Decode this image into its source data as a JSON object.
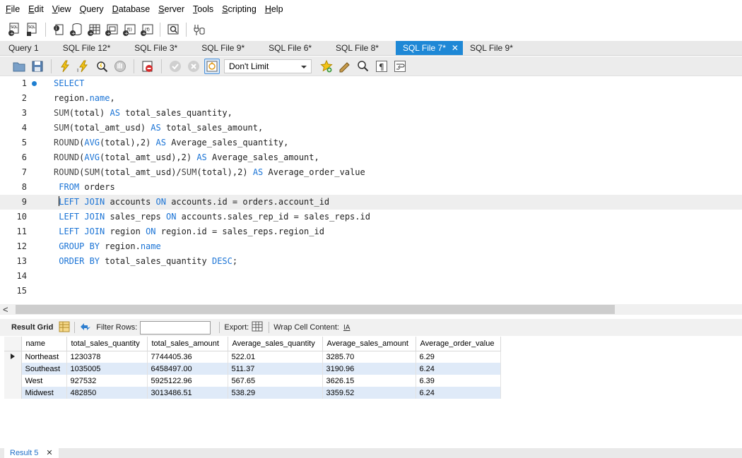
{
  "menu": [
    {
      "label": "File",
      "ul": "F",
      "rest": "ile"
    },
    {
      "label": "Edit",
      "ul": "E",
      "rest": "dit"
    },
    {
      "label": "View",
      "ul": "V",
      "rest": "iew"
    },
    {
      "label": "Query",
      "ul": "Q",
      "rest": "uery"
    },
    {
      "label": "Database",
      "ul": "D",
      "rest": "atabase"
    },
    {
      "label": "Server",
      "ul": "S",
      "rest": "erver"
    },
    {
      "label": "Tools",
      "ul": "T",
      "rest": "ools"
    },
    {
      "label": "Scripting",
      "ul": "S",
      "rest": "cripting"
    },
    {
      "label": "Help",
      "ul": "H",
      "rest": "elp"
    }
  ],
  "tabs": [
    {
      "label": "Query 1",
      "active": false
    },
    {
      "label": "SQL File 12*",
      "active": false
    },
    {
      "label": "SQL File 3*",
      "active": false
    },
    {
      "label": "SQL File 9*",
      "active": false
    },
    {
      "label": "SQL File 6*",
      "active": false
    },
    {
      "label": "SQL File 8*",
      "active": false
    },
    {
      "label": "SQL File 7*",
      "active": true
    },
    {
      "label": "SQL File 9*",
      "active": false
    }
  ],
  "editor_toolbar": {
    "limit_value": "Don't Limit"
  },
  "editor": {
    "current_line": 9,
    "lines": [
      {
        "n": "1",
        "tokens": [
          [
            "kw",
            "SELECT"
          ]
        ]
      },
      {
        "n": "2",
        "tokens": [
          [
            "t",
            "region."
          ],
          [
            "kw",
            "name"
          ],
          [
            "t",
            ","
          ]
        ]
      },
      {
        "n": "3",
        "tokens": [
          [
            "fn",
            "SUM"
          ],
          [
            "t",
            "(total) "
          ],
          [
            "kw",
            "AS"
          ],
          [
            "t",
            " total_sales_quantity,"
          ]
        ]
      },
      {
        "n": "4",
        "tokens": [
          [
            "fn",
            "SUM"
          ],
          [
            "t",
            "(total_amt_usd) "
          ],
          [
            "kw",
            "AS"
          ],
          [
            "t",
            " total_sales_amount,"
          ]
        ]
      },
      {
        "n": "5",
        "tokens": [
          [
            "fn",
            "ROUND"
          ],
          [
            "t",
            "("
          ],
          [
            "kw",
            "AVG"
          ],
          [
            "t",
            "(total),2) "
          ],
          [
            "kw",
            "AS"
          ],
          [
            "t",
            " Average_sales_quantity,"
          ]
        ]
      },
      {
        "n": "6",
        "tokens": [
          [
            "fn",
            "ROUND"
          ],
          [
            "t",
            "("
          ],
          [
            "kw",
            "AVG"
          ],
          [
            "t",
            "(total_amt_usd),2) "
          ],
          [
            "kw",
            "AS"
          ],
          [
            "t",
            " Average_sales_amount,"
          ]
        ]
      },
      {
        "n": "7",
        "tokens": [
          [
            "fn",
            "ROUND"
          ],
          [
            "t",
            "("
          ],
          [
            "fn",
            "SUM"
          ],
          [
            "t",
            "(total_amt_usd)/"
          ],
          [
            "fn",
            "SUM"
          ],
          [
            "t",
            "(total),2) "
          ],
          [
            "kw",
            "AS"
          ],
          [
            "t",
            " Average_order_value"
          ]
        ]
      },
      {
        "n": "8",
        "tokens": [
          [
            "t",
            " "
          ],
          [
            "kw",
            "FROM"
          ],
          [
            "t",
            " orders"
          ]
        ]
      },
      {
        "n": "9",
        "tokens": [
          [
            "t",
            " "
          ],
          [
            "kw",
            "LEFT JOIN"
          ],
          [
            "t",
            " accounts "
          ],
          [
            "kw",
            "ON"
          ],
          [
            "t",
            " accounts.id = orders.account_id"
          ]
        ]
      },
      {
        "n": "10",
        "tokens": [
          [
            "t",
            " "
          ],
          [
            "kw",
            "LEFT JOIN"
          ],
          [
            "t",
            " sales_reps "
          ],
          [
            "kw",
            "ON"
          ],
          [
            "t",
            " accounts.sales_rep_id = sales_reps.id"
          ]
        ]
      },
      {
        "n": "11",
        "tokens": [
          [
            "t",
            " "
          ],
          [
            "kw",
            "LEFT JOIN"
          ],
          [
            "t",
            " region "
          ],
          [
            "kw",
            "ON"
          ],
          [
            "t",
            " region.id = sales_reps.region_id"
          ]
        ]
      },
      {
        "n": "12",
        "tokens": [
          [
            "t",
            " "
          ],
          [
            "kw",
            "GROUP BY"
          ],
          [
            "t",
            " region."
          ],
          [
            "kw",
            "name"
          ]
        ]
      },
      {
        "n": "13",
        "tokens": [
          [
            "t",
            " "
          ],
          [
            "kw",
            "ORDER BY"
          ],
          [
            "t",
            " total_sales_quantity "
          ],
          [
            "kw",
            "DESC"
          ],
          [
            "t",
            ";"
          ]
        ]
      },
      {
        "n": "14",
        "tokens": []
      },
      {
        "n": "15",
        "tokens": []
      }
    ]
  },
  "result_toolbar": {
    "result_grid": "Result Grid",
    "filter_rows": "Filter Rows:",
    "export": "Export:",
    "wrap_cell": "Wrap Cell Content:",
    "wrap_icon": "IA"
  },
  "grid": {
    "columns": [
      "name",
      "total_sales_quantity",
      "total_sales_amount",
      "Average_sales_quantity",
      "Average_sales_amount",
      "Average_order_value"
    ],
    "rows": [
      [
        "Northeast",
        "1230378",
        "7744405.36",
        "522.01",
        "3285.70",
        "6.29"
      ],
      [
        "Southeast",
        "1035005",
        "6458497.00",
        "511.37",
        "3190.96",
        "6.24"
      ],
      [
        "West",
        "927532",
        "5925122.96",
        "567.65",
        "3626.15",
        "6.39"
      ],
      [
        "Midwest",
        "482850",
        "3013486.51",
        "538.29",
        "3359.52",
        "6.24"
      ]
    ]
  },
  "result_tab": "Result 5",
  "colors": {
    "accent": "#1e88d6",
    "keyword": "#1b74d6",
    "alt_row": "#dfeaf8"
  }
}
